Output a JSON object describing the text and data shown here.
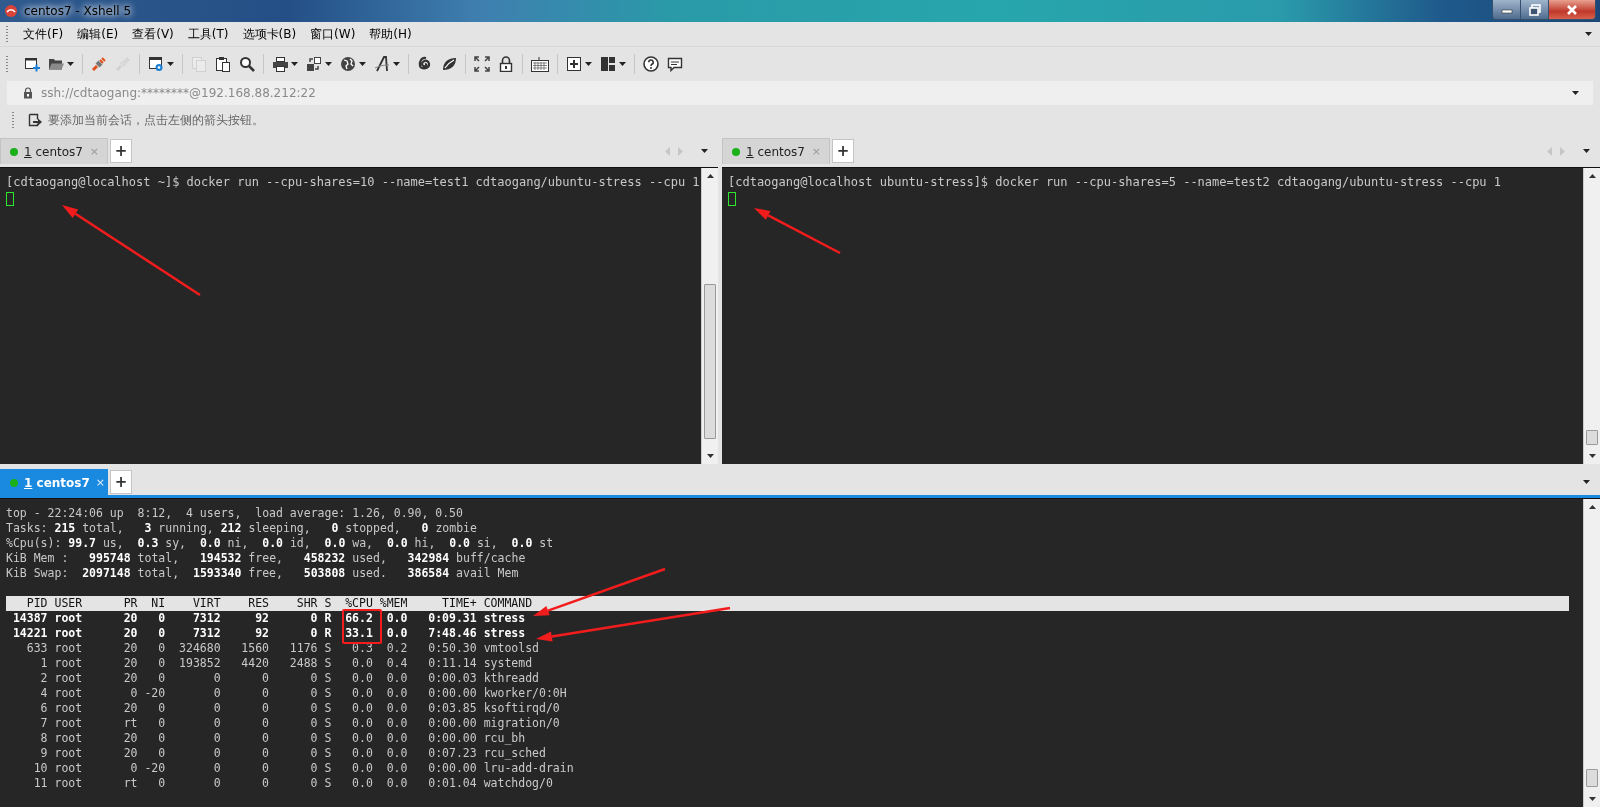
{
  "window": {
    "title": "centos7 - Xshell 5"
  },
  "menu": [
    "文件(F)",
    "编辑(E)",
    "查看(V)",
    "工具(T)",
    "选项卡(B)",
    "窗口(W)",
    "帮助(H)"
  ],
  "toolbar": [
    [
      {
        "kind": "new-session",
        "disabled": false,
        "dropdown": false
      },
      {
        "kind": "open",
        "disabled": false,
        "dropdown": true
      }
    ],
    [
      {
        "kind": "connect",
        "disabled": false,
        "dropdown": false
      },
      {
        "kind": "disconnect",
        "disabled": true,
        "dropdown": false
      }
    ],
    [
      {
        "kind": "properties",
        "disabled": false,
        "dropdown": true
      }
    ],
    [
      {
        "kind": "copy",
        "disabled": true,
        "dropdown": false
      },
      {
        "kind": "paste",
        "disabled": false,
        "dropdown": false
      },
      {
        "kind": "find",
        "disabled": false,
        "dropdown": false
      }
    ],
    [
      {
        "kind": "print",
        "disabled": false,
        "dropdown": true
      },
      {
        "kind": "transfer",
        "disabled": false,
        "dropdown": true
      },
      {
        "kind": "globe",
        "disabled": false,
        "dropdown": true
      },
      {
        "kind": "font",
        "disabled": false,
        "dropdown": true
      }
    ],
    [
      {
        "kind": "spiral",
        "disabled": false,
        "dropdown": false
      },
      {
        "kind": "leaf",
        "disabled": false,
        "dropdown": false
      }
    ],
    [
      {
        "kind": "fullscreen",
        "disabled": false,
        "dropdown": false
      },
      {
        "kind": "lock",
        "disabled": false,
        "dropdown": false
      }
    ],
    [
      {
        "kind": "keyboard",
        "disabled": false,
        "dropdown": false
      }
    ],
    [
      {
        "kind": "new-tab",
        "disabled": false,
        "dropdown": true
      },
      {
        "kind": "layout",
        "disabled": false,
        "dropdown": true
      }
    ],
    [
      {
        "kind": "help",
        "disabled": false,
        "dropdown": false
      },
      {
        "kind": "chat",
        "disabled": false,
        "dropdown": false
      }
    ]
  ],
  "address_bar": {
    "value": "ssh://cdtaogang:********@192.168.88.212:22"
  },
  "hint_bar": {
    "text": "要添加当前会话，点击左侧的箭头按钮。"
  },
  "panes": [
    {
      "tab": {
        "number": "1",
        "title": "centos7",
        "selected": false,
        "close": "×"
      },
      "new_tab": "+",
      "nav_arrows": true,
      "lines": [
        "[cdtaogang@localhost ~]$ docker run --cpu-shares=10 --name=test1 cdtaogang/ubuntu-stress --cpu 1"
      ],
      "cursor": true
    },
    {
      "tab": {
        "number": "1",
        "title": "centos7",
        "selected": false,
        "close": "×"
      },
      "new_tab": "+",
      "nav_arrows": true,
      "lines": [
        "[cdtaogang@localhost ubuntu-stress]$ docker run --cpu-shares=5 --name=test2 cdtaogang/ubuntu-stress --cpu 1"
      ],
      "cursor": true
    },
    {
      "tab": {
        "number": "1",
        "title": "centos7",
        "selected": true,
        "close": "×"
      },
      "new_tab": "+",
      "nav_arrows": false,
      "cursor": false,
      "summary": [
        "top - 22:24:06 up  8:12,  4 users,  load average: 1.26, 0.90, 0.50",
        "Tasks: **215** total,   **3** running, **212** sleeping,   **0** stopped,   **0** zombie",
        "%Cpu(s): **99.7** us,  **0.3** sy,  **0.0** ni,  **0.0** id,  **0.0** wa,  **0.0** hi,  **0.0** si,  **0.0** st",
        "KiB Mem :   **995748** total,   **194532** free,   **458232** used,   **342984** buff/cache",
        "KiB Swap:  **2097148** total,  **1593340** free,   **503808** used.   **386584** avail Mem"
      ],
      "process_table": {
        "columns": [
          "PID",
          "USER",
          "PR",
          "NI",
          "VIRT",
          "RES",
          "SHR",
          "S",
          "%CPU",
          "%MEM",
          "TIME+",
          "COMMAND"
        ],
        "rows": [
          {
            "cells": [
              "14387",
              "root",
              "20",
              "0",
              "7312",
              "92",
              "0",
              "R",
              "66.2",
              "0.0",
              "0:09.31",
              "stress"
            ],
            "highlighted": true
          },
          {
            "cells": [
              "14221",
              "root",
              "20",
              "0",
              "7312",
              "92",
              "0",
              "R",
              "33.1",
              "0.0",
              "7:48.46",
              "stress"
            ],
            "highlighted": true
          },
          {
            "cells": [
              "633",
              "root",
              "20",
              "0",
              "324680",
              "1560",
              "1176",
              "S",
              "0.3",
              "0.2",
              "0:50.30",
              "vmtoolsd"
            ],
            "highlighted": false
          },
          {
            "cells": [
              "1",
              "root",
              "20",
              "0",
              "193852",
              "4420",
              "2488",
              "S",
              "0.0",
              "0.4",
              "0:11.14",
              "systemd"
            ],
            "highlighted": false
          },
          {
            "cells": [
              "2",
              "root",
              "20",
              "0",
              "0",
              "0",
              "0",
              "S",
              "0.0",
              "0.0",
              "0:00.03",
              "kthreadd"
            ],
            "highlighted": false
          },
          {
            "cells": [
              "4",
              "root",
              "0",
              "-20",
              "0",
              "0",
              "0",
              "S",
              "0.0",
              "0.0",
              "0:00.00",
              "kworker/0:0H"
            ],
            "highlighted": false
          },
          {
            "cells": [
              "6",
              "root",
              "20",
              "0",
              "0",
              "0",
              "0",
              "S",
              "0.0",
              "0.0",
              "0:03.85",
              "ksoftirqd/0"
            ],
            "highlighted": false
          },
          {
            "cells": [
              "7",
              "root",
              "rt",
              "0",
              "0",
              "0",
              "0",
              "S",
              "0.0",
              "0.0",
              "0:00.00",
              "migration/0"
            ],
            "highlighted": false
          },
          {
            "cells": [
              "8",
              "root",
              "20",
              "0",
              "0",
              "0",
              "0",
              "S",
              "0.0",
              "0.0",
              "0:00.00",
              "rcu_bh"
            ],
            "highlighted": false
          },
          {
            "cells": [
              "9",
              "root",
              "20",
              "0",
              "0",
              "0",
              "0",
              "S",
              "0.0",
              "0.0",
              "0:07.23",
              "rcu_sched"
            ],
            "highlighted": false
          },
          {
            "cells": [
              "10",
              "root",
              "0",
              "-20",
              "0",
              "0",
              "0",
              "S",
              "0.0",
              "0.0",
              "0:00.00",
              "lru-add-drain"
            ],
            "highlighted": false
          },
          {
            "cells": [
              "11",
              "root",
              "rt",
              "0",
              "0",
              "0",
              "0",
              "S",
              "0.0",
              "0.0",
              "0:01.04",
              "watchdog/0"
            ],
            "highlighted": false
          }
        ]
      }
    }
  ]
}
